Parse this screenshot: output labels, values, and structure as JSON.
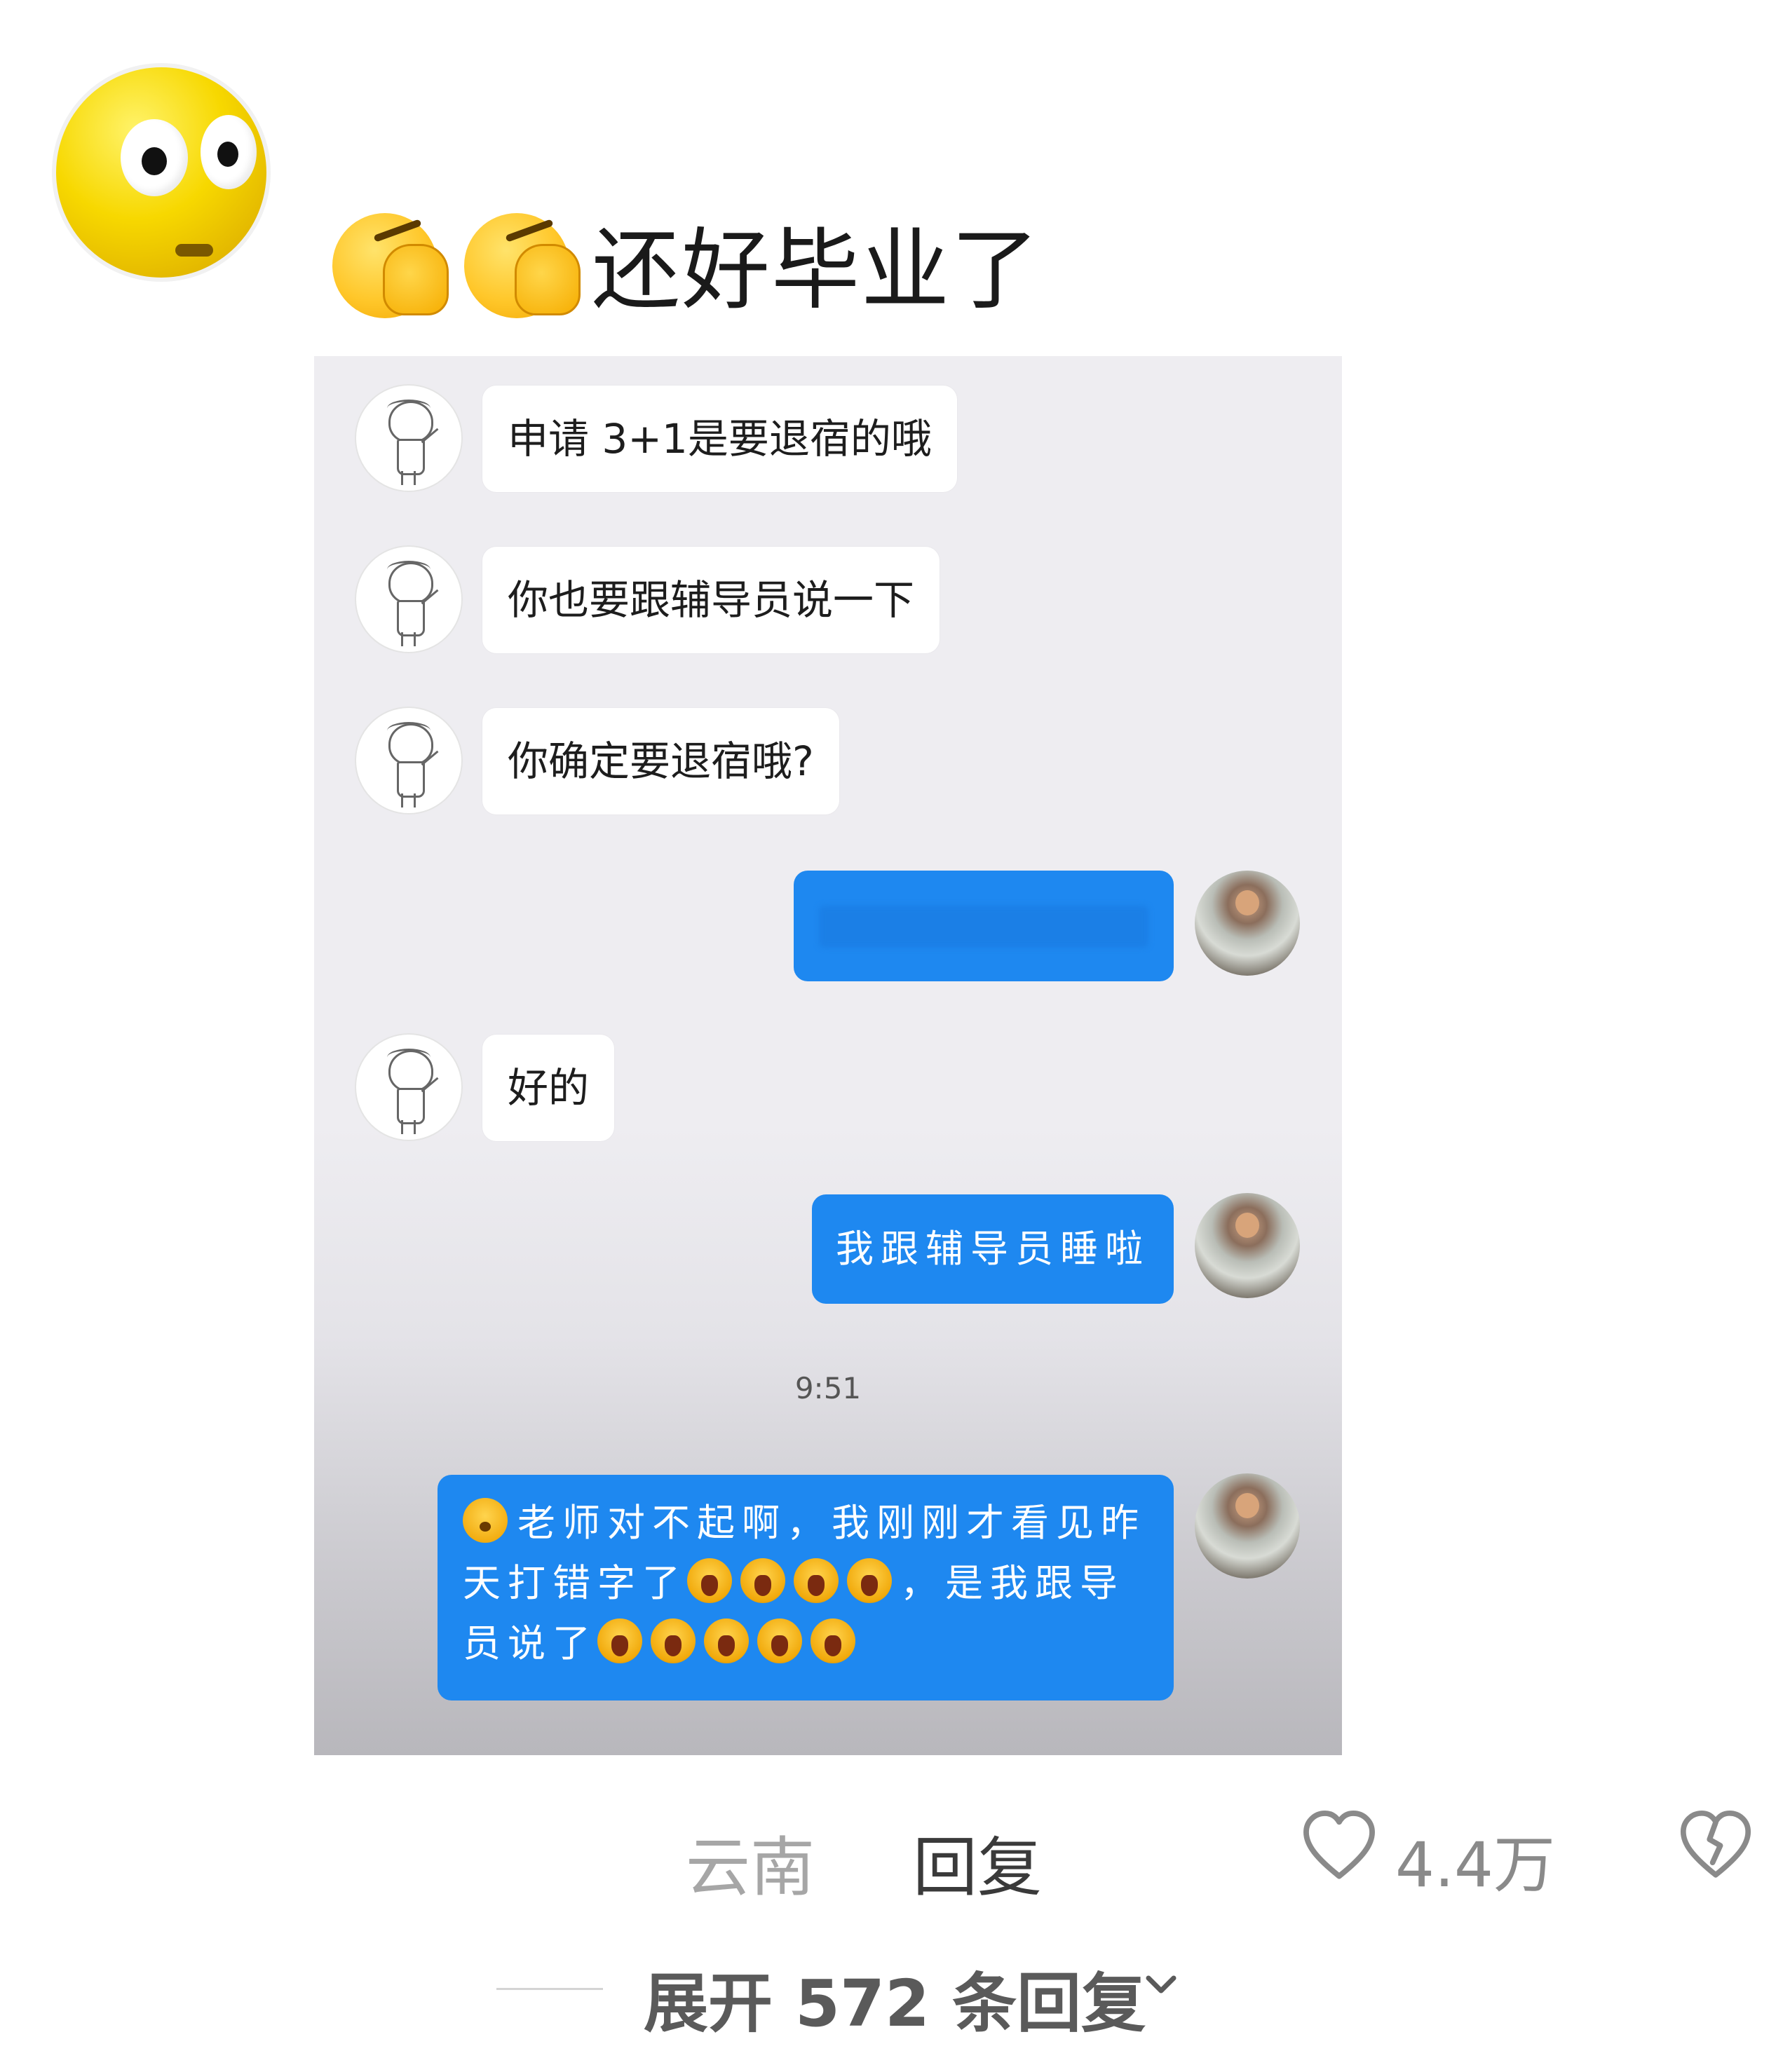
{
  "comment": {
    "text": "还好毕业了",
    "emojis": [
      "face-palm-icon",
      "face-palm-icon"
    ]
  },
  "chat": {
    "messages": [
      {
        "side": "left",
        "text": "申请 3+1是要退宿的哦"
      },
      {
        "side": "left",
        "text": "你也要跟辅导员说一下"
      },
      {
        "side": "left",
        "text": "你确定要退宿哦?"
      },
      {
        "side": "right",
        "text": ""
      },
      {
        "side": "left",
        "text": "好的"
      },
      {
        "side": "right",
        "text": "我跟辅导员睡啦"
      }
    ],
    "timestamp": "9:51",
    "last_message": {
      "side": "right",
      "part1": "老师对不起啊，我刚刚才看见昨天打错字了",
      "part2": "，是我跟导员说了"
    }
  },
  "footer": {
    "location": "云南",
    "reply_label": "回复",
    "like_count": "4.4万",
    "expand_label": "展开 572 条回复"
  },
  "colors": {
    "bubble_blue": "#1e88f0",
    "panel_bg": "#eeedf1",
    "avatar_yellow": "#f7d800"
  }
}
